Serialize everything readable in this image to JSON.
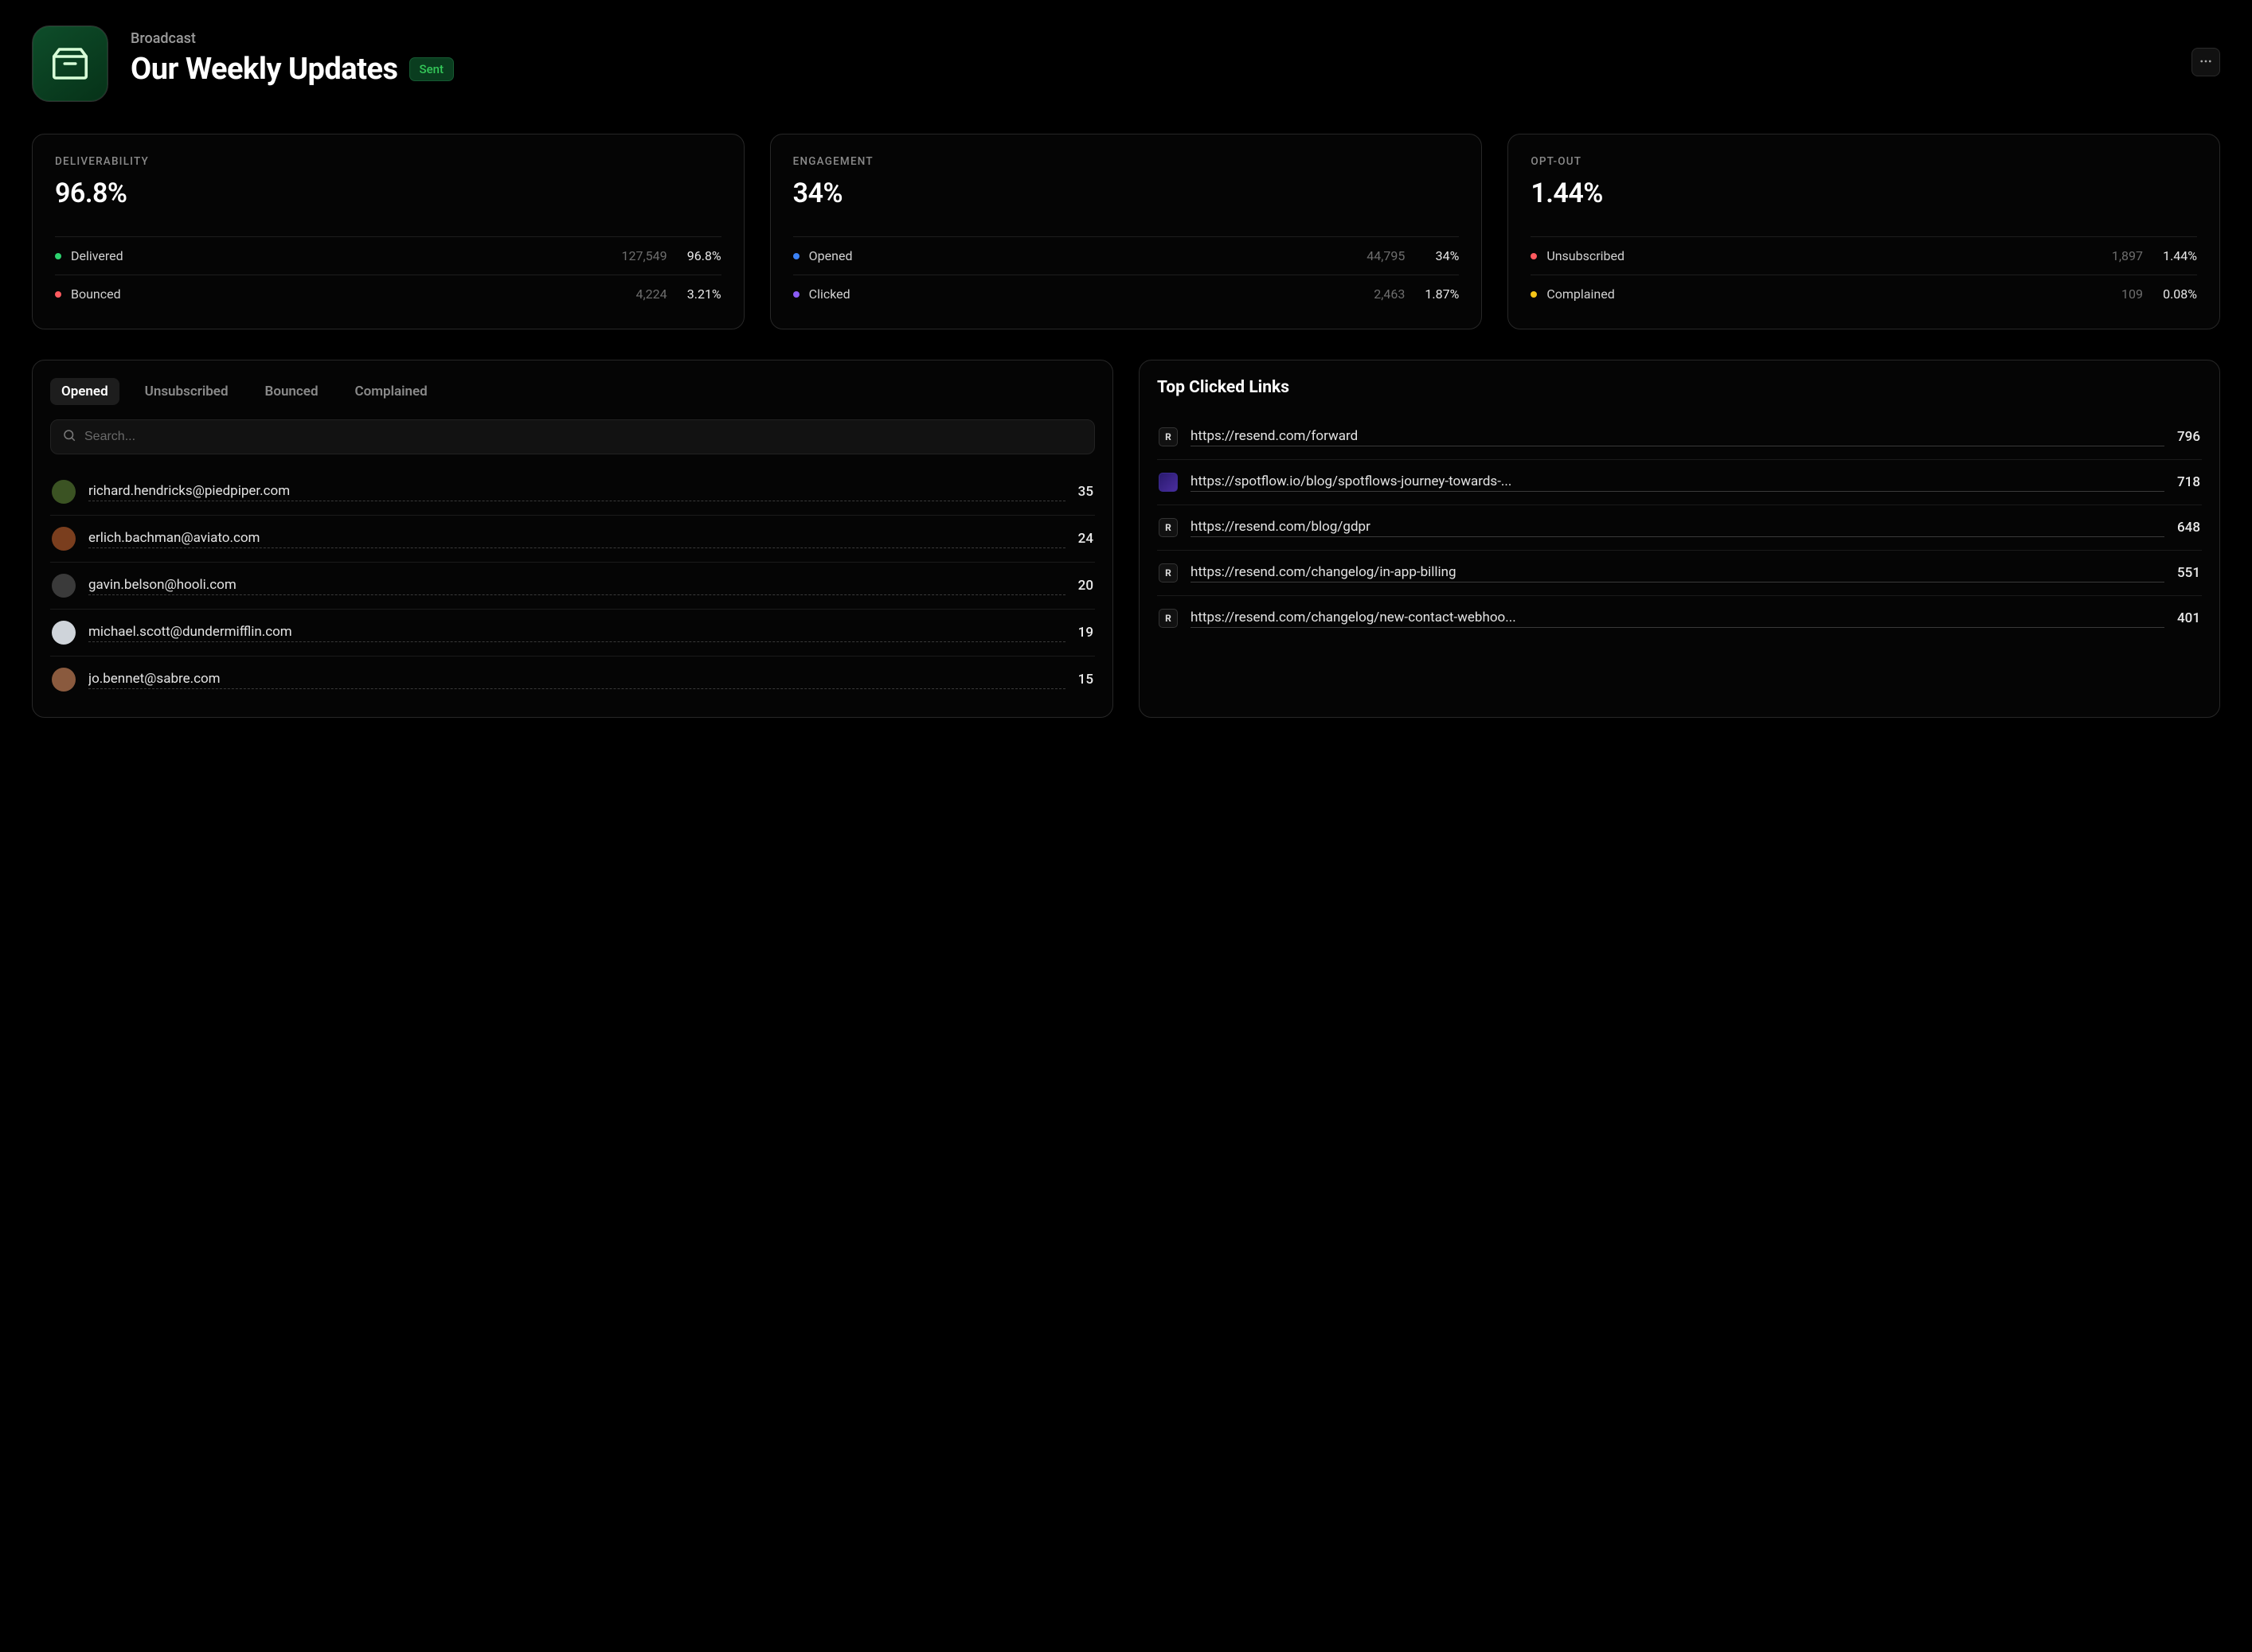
{
  "header": {
    "breadcrumb": "Broadcast",
    "title": "Our Weekly Updates",
    "status": "Sent"
  },
  "metrics": [
    {
      "title": "DELIVERABILITY",
      "value": "96.8%",
      "rows": [
        {
          "label": "Delivered",
          "count": "127,549",
          "pct": "96.8%",
          "dot": "#2dd36f"
        },
        {
          "label": "Bounced",
          "count": "4,224",
          "pct": "3.21%",
          "dot": "#ff5a5f"
        }
      ]
    },
    {
      "title": "ENGAGEMENT",
      "value": "34%",
      "rows": [
        {
          "label": "Opened",
          "count": "44,795",
          "pct": "34%",
          "dot": "#3b82f6"
        },
        {
          "label": "Clicked",
          "count": "2,463",
          "pct": "1.87%",
          "dot": "#8b5cf6"
        }
      ]
    },
    {
      "title": "OPT-OUT",
      "value": "1.44%",
      "rows": [
        {
          "label": "Unsubscribed",
          "count": "1,897",
          "pct": "1.44%",
          "dot": "#ff5a5f"
        },
        {
          "label": "Complained",
          "count": "109",
          "pct": "0.08%",
          "dot": "#f5c518"
        }
      ]
    }
  ],
  "emailPanel": {
    "tabs": [
      "Opened",
      "Unsubscribed",
      "Bounced",
      "Complained"
    ],
    "activeTab": 0,
    "searchPlaceholder": "Search...",
    "items": [
      {
        "email": "richard.hendricks@piedpiper.com",
        "count": "35",
        "avatarBg": "#3b5323"
      },
      {
        "email": "erlich.bachman@aviato.com",
        "count": "24",
        "avatarBg": "#7a3e1e"
      },
      {
        "email": "gavin.belson@hooli.com",
        "count": "20",
        "avatarBg": "#3a3a3a"
      },
      {
        "email": "michael.scott@dundermifflin.com",
        "count": "19",
        "avatarBg": "#cfd4da"
      },
      {
        "email": "jo.bennet@sabre.com",
        "count": "15",
        "avatarBg": "#8a5a3e"
      }
    ]
  },
  "linksPanel": {
    "title": "Top Clicked Links",
    "items": [
      {
        "url": "https://resend.com/forward",
        "count": "796",
        "icon": "R"
      },
      {
        "url": "https://spotflow.io/blog/spotflows-journey-towards-...",
        "count": "718",
        "icon": "spot"
      },
      {
        "url": "https://resend.com/blog/gdpr",
        "count": "648",
        "icon": "R"
      },
      {
        "url": "https://resend.com/changelog/in-app-billing",
        "count": "551",
        "icon": "R"
      },
      {
        "url": "https://resend.com/changelog/new-contact-webhoo...",
        "count": "401",
        "icon": "R"
      }
    ]
  }
}
